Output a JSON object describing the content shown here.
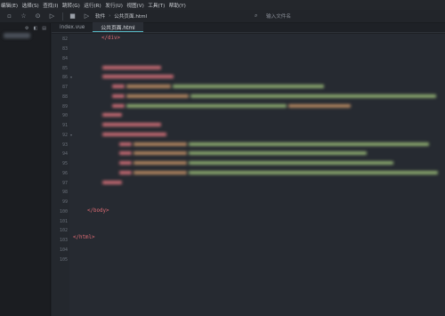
{
  "menubar": {
    "items": [
      "编辑(E)",
      "选择(S)",
      "查找(I)",
      "跳转(G)",
      "运行(R)",
      "发行(U)",
      "视图(V)",
      "工具(T)",
      "帮助(Y)"
    ]
  },
  "toolbar": {
    "breadcrumb": [
      "软件",
      "公共页面.html"
    ],
    "search_placeholder": "输入文件名"
  },
  "tabs": [
    {
      "label": "index.vue",
      "active": false
    },
    {
      "label": "公共页面.html",
      "active": true
    }
  ],
  "editor": {
    "lines": {
      "l82": {
        "num": "82",
        "code": "</div>"
      },
      "l83": {
        "num": "83"
      },
      "l84": {
        "num": "84"
      },
      "l85": {
        "num": "85"
      },
      "l86": {
        "num": "86"
      },
      "l87": {
        "num": "87"
      },
      "l88": {
        "num": "88"
      },
      "l89": {
        "num": "89"
      },
      "l90": {
        "num": "90"
      },
      "l91": {
        "num": "91"
      },
      "l92": {
        "num": "92"
      },
      "l93": {
        "num": "93"
      },
      "l94": {
        "num": "94"
      },
      "l95": {
        "num": "95"
      },
      "l96": {
        "num": "96"
      },
      "l97": {
        "num": "97"
      },
      "l98": {
        "num": "98"
      },
      "l99": {
        "num": "99"
      },
      "l100": {
        "num": "100"
      },
      "l101": {
        "num": "101"
      },
      "l102": {
        "num": "102",
        "code": "</body>"
      },
      "l103": {
        "num": "103"
      },
      "l104": {
        "num": "104"
      },
      "l105": {
        "num": "105",
        "code": "</html>"
      }
    }
  },
  "colors": {
    "tag": "#e06c75",
    "string": "#98c379",
    "attr": "#d19a66",
    "accent": "#56b6c2"
  }
}
